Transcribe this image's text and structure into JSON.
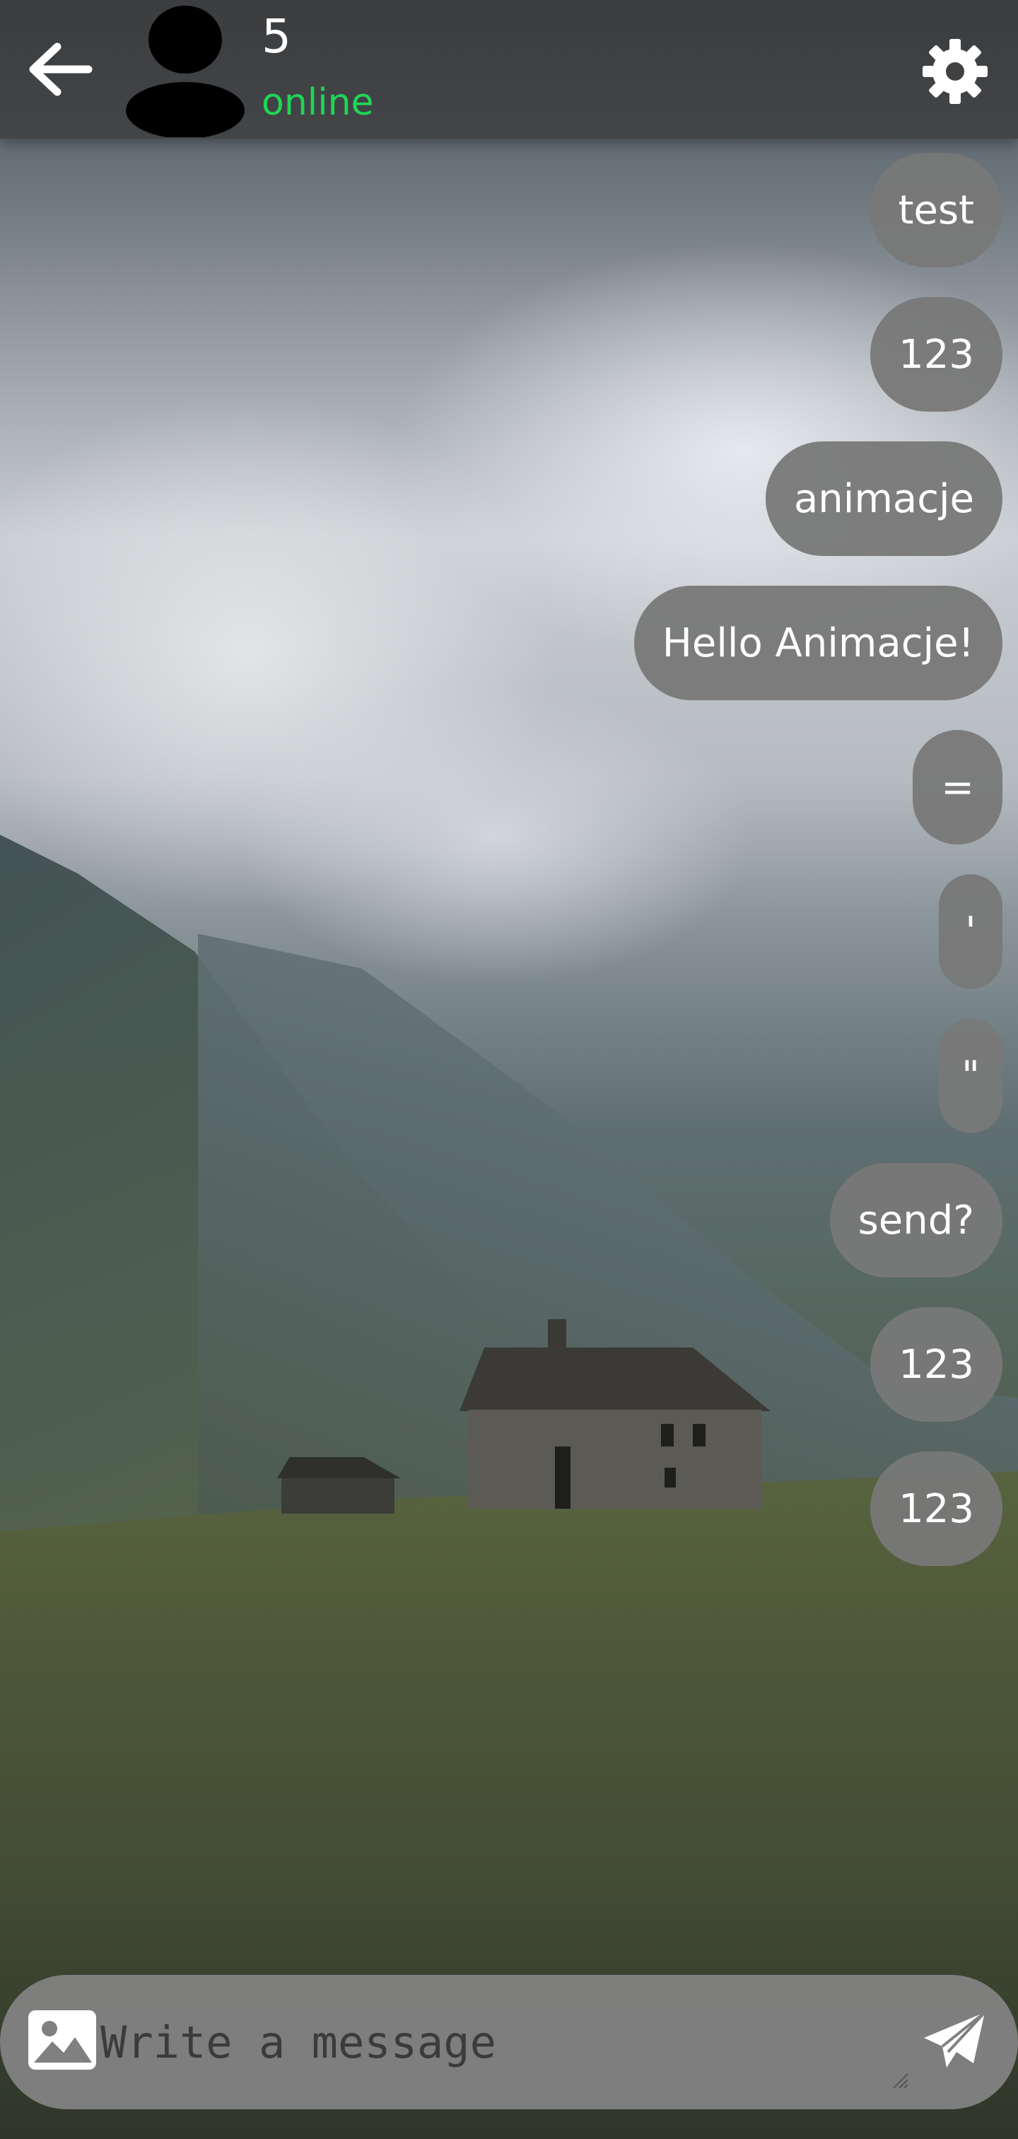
{
  "header": {
    "contact_name": "5",
    "status": "online",
    "back_icon": "arrow-left-icon",
    "settings_icon": "gear-icon"
  },
  "colors": {
    "status_online": "#1fd655",
    "bubble": "#787878",
    "header": "#3c3e40",
    "composer": "#808080"
  },
  "messages": [
    {
      "text": "test"
    },
    {
      "text": "123"
    },
    {
      "text": "animacje"
    },
    {
      "text": "Hello Animacje!"
    },
    {
      "text": "="
    },
    {
      "text": "'"
    },
    {
      "text": "\""
    },
    {
      "text": "send?"
    },
    {
      "text": "123"
    },
    {
      "text": "123"
    }
  ],
  "composer": {
    "placeholder": "Write a message",
    "value": "",
    "image_icon": "image-icon",
    "send_icon": "paper-plane-icon"
  }
}
